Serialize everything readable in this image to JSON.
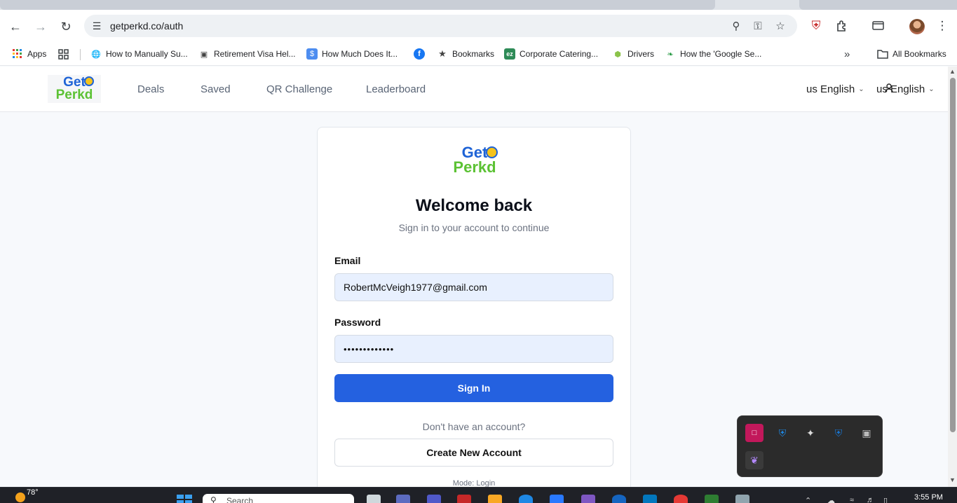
{
  "browser": {
    "url": "getperkd.co/auth",
    "bookmarks": [
      {
        "label": "Apps",
        "icon": "apps-grid-icon"
      },
      {
        "label": "",
        "icon": "tab-groups-icon"
      },
      {
        "label": "How to Manually Su...",
        "icon": "globe-icon"
      },
      {
        "label": "Retirement Visa Hel...",
        "icon": "briefcase-icon"
      },
      {
        "label": "How Much Does It...",
        "icon": "dollar-icon"
      },
      {
        "label": "",
        "icon": "facebook-icon"
      },
      {
        "label": "Bookmarks",
        "icon": "star-icon"
      },
      {
        "label": "Corporate Catering...",
        "icon": "ez-icon"
      },
      {
        "label": "Drivers",
        "icon": "shield-icon"
      },
      {
        "label": "How the 'Google Se...",
        "icon": "leaf-icon"
      }
    ],
    "more_bookmarks_glyph": "»",
    "all_bookmarks": "All Bookmarks"
  },
  "site": {
    "logo_top": "Get",
    "logo_bottom": "Perkd",
    "nav": [
      "Deals",
      "Saved",
      "QR Challenge",
      "Leaderboard"
    ],
    "language_1": "us English",
    "language_2": "us English"
  },
  "login": {
    "title": "Welcome back",
    "subtitle": "Sign in to your account to continue",
    "email_label": "Email",
    "email_value": "RobertMcVeigh1977@gmail.com",
    "password_label": "Password",
    "password_value": "•••••••••••••",
    "sign_in": "Sign In",
    "no_account": "Don't have an account?",
    "create_account": "Create New Account",
    "mode": "Mode: Login"
  },
  "taskbar": {
    "weather": "78°",
    "search_placeholder": "Search",
    "time": "3:55 PM"
  },
  "colors": {
    "primary": "#2461e0",
    "logo_blue": "#1e63d6",
    "logo_green": "#5cc234",
    "input_fill": "#e8f0fe"
  }
}
